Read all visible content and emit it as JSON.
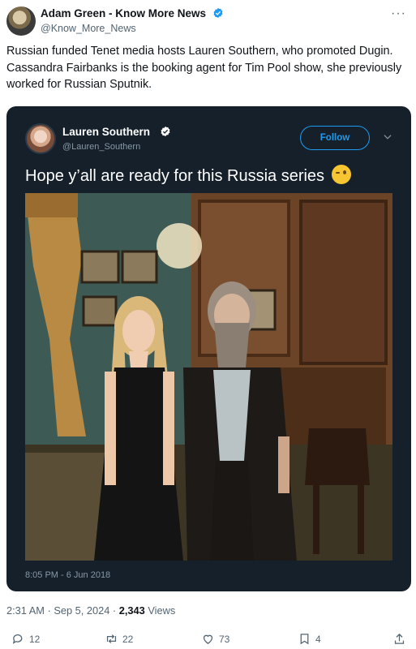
{
  "author": {
    "name": "Adam Green - Know More News",
    "handle": "@Know_More_News",
    "verified_color": "#1d9bf0"
  },
  "tweet": {
    "text": "Russian funded Tenet media hosts Lauren Southern, who promoted Dugin. Cassandra Fairbanks is the booking agent for Tim Pool show, she previously worked for Russian Sputnik."
  },
  "embedded_tweet": {
    "name": "Lauren Southern",
    "handle": "@Lauren_Southern",
    "follow_label": "Follow",
    "text": "Hope y’all are ready for this Russia series",
    "emoji": "winking-face-icon",
    "timestamp": "8:05 PM - 6 Jun 2018",
    "background": "#15202b",
    "photo_description_icon": "photo-icon"
  },
  "meta": {
    "time": "2:31 AM",
    "separator": " · ",
    "date": "Sep 5, 2024",
    "views_count": "2,343",
    "views_label": "Views"
  },
  "actions": {
    "replies": "12",
    "reposts": "22",
    "likes": "73",
    "bookmarks": "4"
  },
  "icons": [
    "more-icon",
    "verified-badge-icon",
    "chevron-down-icon",
    "reply-icon",
    "repost-icon",
    "like-icon",
    "bookmark-icon",
    "share-icon"
  ]
}
